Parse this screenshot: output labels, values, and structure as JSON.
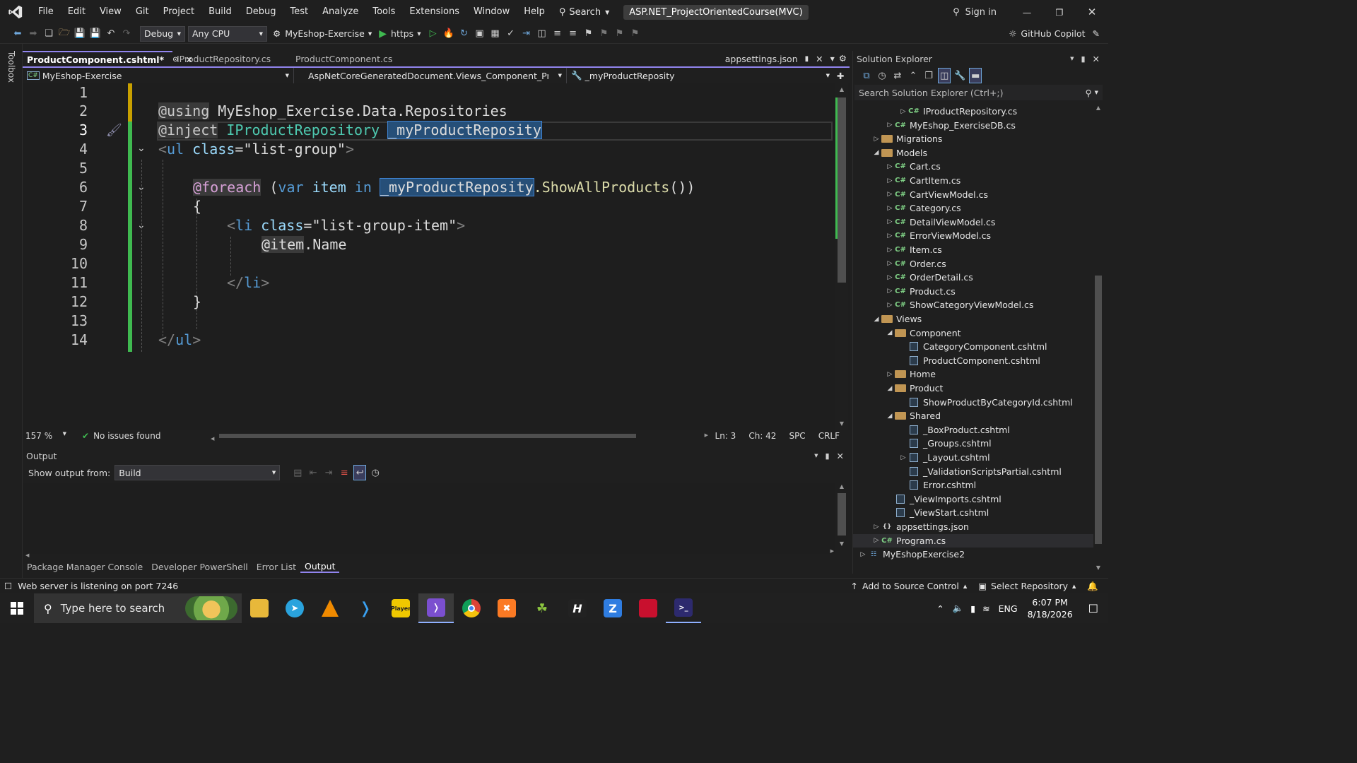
{
  "titlebar": {
    "menu": [
      "File",
      "Edit",
      "View",
      "Git",
      "Project",
      "Build",
      "Debug",
      "Test",
      "Analyze",
      "Tools",
      "Extensions",
      "Window",
      "Help"
    ],
    "search_label": "Search",
    "solution_title": "ASP.NET_ProjectOrientedCourse(MVC)",
    "sign_in": "Sign in"
  },
  "toolbar": {
    "config": "Debug",
    "platform": "Any CPU",
    "startup_project": "MyEshop-Exercise",
    "run_profile": "https",
    "copilot": "GitHub Copilot"
  },
  "toolbox_label": "Toolbox",
  "tabs": {
    "items": [
      {
        "label": "ProductComponent.cshtml*",
        "active": true
      },
      {
        "label": "IProductRepository.cs",
        "active": false
      },
      {
        "label": "ProductComponent.cs",
        "active": false
      }
    ],
    "right_tab": "appsettings.json"
  },
  "navbar": {
    "project": "MyEshop-Exercise",
    "type": "AspNetCoreGeneratedDocument.Views_Component_ProductCo",
    "member": "_myProductReposity"
  },
  "editor": {
    "line_numbers": [
      "1",
      "2",
      "3",
      "4",
      "5",
      "6",
      "7",
      "8",
      "9",
      "10",
      "11",
      "12",
      "13",
      "14"
    ],
    "line2": {
      "using": "@using",
      "ns": " MyEshop_Exercise.Data.Repositories"
    },
    "line3": {
      "inject": "@inject",
      "type": "IProductRepository",
      "field": "_myProductReposity"
    },
    "line4": {
      "open": "<",
      "tag": "ul",
      "attr": " class",
      "eq": "=",
      "val": "\"list-group\"",
      "close": ">"
    },
    "line6": {
      "foreach": "@foreach",
      "paren": " (",
      "var": "var",
      "item": " item",
      "in": " in",
      "field": "_myProductReposity",
      "call": ".ShowAllProducts",
      "end": "())"
    },
    "line7": "{",
    "line8": {
      "open": "<",
      "tag": "li",
      "attr": " class",
      "eq": "=",
      "val": "\"list-group-item\"",
      "close": ">"
    },
    "line9": {
      "at": "@item",
      "prop": ".Name"
    },
    "line11": {
      "open": "</",
      "tag": "li",
      "close": ">"
    },
    "line12": "}",
    "line14": {
      "open": "</",
      "tag": "ul",
      "close": ">"
    }
  },
  "status": {
    "zoom": "157 %",
    "issues": "No issues found",
    "ln": "Ln: 3",
    "ch": "Ch: 42",
    "spc": "SPC",
    "crlf": "CRLF"
  },
  "output": {
    "title": "Output",
    "show_from_label": "Show output from:",
    "show_from_value": "Build"
  },
  "bottom_tabs": [
    "Package Manager Console",
    "Developer PowerShell",
    "Error List",
    "Output"
  ],
  "solution_explorer": {
    "title": "Solution Explorer",
    "search_placeholder": "Search Solution Explorer (Ctrl+;)",
    "items": [
      {
        "label": "IProductRepository.cs",
        "kind": "cs"
      },
      {
        "label": "MyEshop_ExerciseDB.cs",
        "kind": "cs"
      },
      {
        "label": "Migrations",
        "kind": "folder"
      },
      {
        "label": "Models",
        "kind": "folder"
      },
      {
        "label": "Cart.cs",
        "kind": "cs"
      },
      {
        "label": "CartItem.cs",
        "kind": "cs"
      },
      {
        "label": "CartViewModel.cs",
        "kind": "cs"
      },
      {
        "label": "Category.cs",
        "kind": "cs"
      },
      {
        "label": "DetailViewModel.cs",
        "kind": "cs"
      },
      {
        "label": "ErrorViewModel.cs",
        "kind": "cs"
      },
      {
        "label": "Item.cs",
        "kind": "cs"
      },
      {
        "label": "Order.cs",
        "kind": "cs"
      },
      {
        "label": "OrderDetail.cs",
        "kind": "cs"
      },
      {
        "label": "Product.cs",
        "kind": "cs"
      },
      {
        "label": "ShowCategoryViewModel.cs",
        "kind": "cs"
      },
      {
        "label": "Views",
        "kind": "folder"
      },
      {
        "label": "Component",
        "kind": "folder"
      },
      {
        "label": "CategoryComponent.cshtml",
        "kind": "cshtml"
      },
      {
        "label": "ProductComponent.cshtml",
        "kind": "cshtml"
      },
      {
        "label": "Home",
        "kind": "folder"
      },
      {
        "label": "Product",
        "kind": "folder"
      },
      {
        "label": "ShowProductByCategoryId.cshtml",
        "kind": "cshtml"
      },
      {
        "label": "Shared",
        "kind": "folder"
      },
      {
        "label": "_BoxProduct.cshtml",
        "kind": "cshtml"
      },
      {
        "label": "_Groups.cshtml",
        "kind": "cshtml"
      },
      {
        "label": "_Layout.cshtml",
        "kind": "cshtml"
      },
      {
        "label": "_ValidationScriptsPartial.cshtml",
        "kind": "cshtml"
      },
      {
        "label": "Error.cshtml",
        "kind": "cshtml"
      },
      {
        "label": "_ViewImports.cshtml",
        "kind": "cshtml"
      },
      {
        "label": "_ViewStart.cshtml",
        "kind": "cshtml"
      },
      {
        "label": "appsettings.json",
        "kind": "json"
      },
      {
        "label": "Program.cs",
        "kind": "cs"
      },
      {
        "label": "MyEshopExercise2",
        "kind": "project"
      }
    ]
  },
  "app_status": {
    "message": "Web server is listening on port 7246",
    "source_control": "Add to Source Control",
    "repository": "Select Repository"
  },
  "taskbar": {
    "search_placeholder": "Type here to search",
    "lang": "ENG",
    "time": "6:07 PM",
    "date": "8/18/2026"
  },
  "colors": {
    "accent": "#9184ee",
    "keyword": "#569cd6",
    "type": "#4ec9b0",
    "string": "#d69d85",
    "method": "#dcdcaa",
    "changed_bar": "#3fb950"
  }
}
